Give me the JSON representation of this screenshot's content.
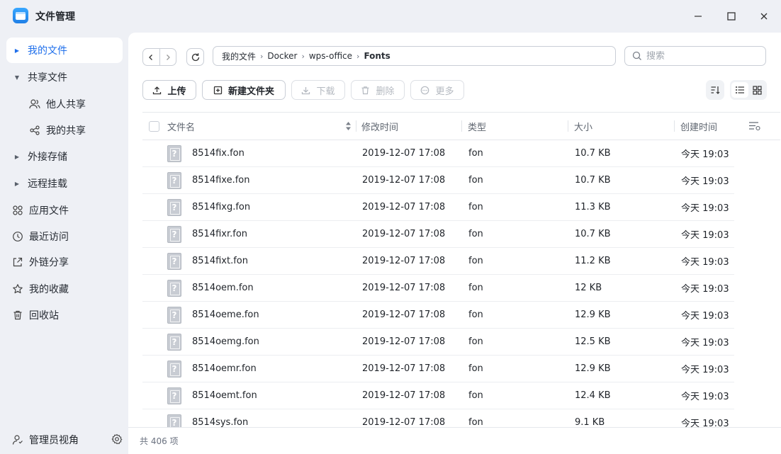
{
  "app": {
    "title": "文件管理"
  },
  "sidebar": {
    "items": [
      {
        "label": "我的文件",
        "type": "caret",
        "active": true
      },
      {
        "label": "共享文件",
        "type": "caret-open"
      },
      {
        "label": "他人共享",
        "type": "sub",
        "icon": "users-icon"
      },
      {
        "label": "我的共享",
        "type": "sub",
        "icon": "share-icon"
      },
      {
        "label": "外接存储",
        "type": "caret"
      },
      {
        "label": "远程挂载",
        "type": "caret"
      },
      {
        "label": "应用文件",
        "type": "icon",
        "icon": "apps-icon"
      },
      {
        "label": "最近访问",
        "type": "icon",
        "icon": "clock-icon"
      },
      {
        "label": "外链分享",
        "type": "icon",
        "icon": "link-share-icon"
      },
      {
        "label": "我的收藏",
        "type": "icon",
        "icon": "star-icon"
      },
      {
        "label": "回收站",
        "type": "icon",
        "icon": "trash-icon"
      }
    ],
    "footer_label": "管理员视角"
  },
  "breadcrumb": {
    "parts": [
      "我的文件",
      "Docker",
      "wps-office"
    ],
    "current": "Fonts"
  },
  "search": {
    "placeholder": "搜索",
    "value": ""
  },
  "toolbar": {
    "upload": "上传",
    "new_folder": "新建文件夹",
    "download": "下载",
    "delete": "删除",
    "more": "更多"
  },
  "table": {
    "headers": {
      "name": "文件名",
      "modified": "修改时间",
      "type": "类型",
      "size": "大小",
      "created": "创建时间"
    },
    "rows": [
      {
        "name": "8514fix.fon",
        "modified": "2019-12-07 17:08",
        "type": "fon",
        "size": "10.7 KB",
        "created": "今天 19:03"
      },
      {
        "name": "8514fixe.fon",
        "modified": "2019-12-07 17:08",
        "type": "fon",
        "size": "10.7 KB",
        "created": "今天 19:03"
      },
      {
        "name": "8514fixg.fon",
        "modified": "2019-12-07 17:08",
        "type": "fon",
        "size": "11.3 KB",
        "created": "今天 19:03"
      },
      {
        "name": "8514fixr.fon",
        "modified": "2019-12-07 17:08",
        "type": "fon",
        "size": "10.7 KB",
        "created": "今天 19:03"
      },
      {
        "name": "8514fixt.fon",
        "modified": "2019-12-07 17:08",
        "type": "fon",
        "size": "11.2 KB",
        "created": "今天 19:03"
      },
      {
        "name": "8514oem.fon",
        "modified": "2019-12-07 17:08",
        "type": "fon",
        "size": "12 KB",
        "created": "今天 19:03"
      },
      {
        "name": "8514oeme.fon",
        "modified": "2019-12-07 17:08",
        "type": "fon",
        "size": "12.9 KB",
        "created": "今天 19:03"
      },
      {
        "name": "8514oemg.fon",
        "modified": "2019-12-07 17:08",
        "type": "fon",
        "size": "12.5 KB",
        "created": "今天 19:03"
      },
      {
        "name": "8514oemr.fon",
        "modified": "2019-12-07 17:08",
        "type": "fon",
        "size": "12.9 KB",
        "created": "今天 19:03"
      },
      {
        "name": "8514oemt.fon",
        "modified": "2019-12-07 17:08",
        "type": "fon",
        "size": "12.4 KB",
        "created": "今天 19:03"
      },
      {
        "name": "8514sys.fon",
        "modified": "2019-12-07 17:08",
        "type": "fon",
        "size": "9.1 KB",
        "created": "今天 19:03"
      }
    ]
  },
  "status": {
    "count_text": "共 406 项"
  },
  "colors": {
    "accent": "#1f6feb",
    "sidebar_bg": "#eef0f5"
  }
}
